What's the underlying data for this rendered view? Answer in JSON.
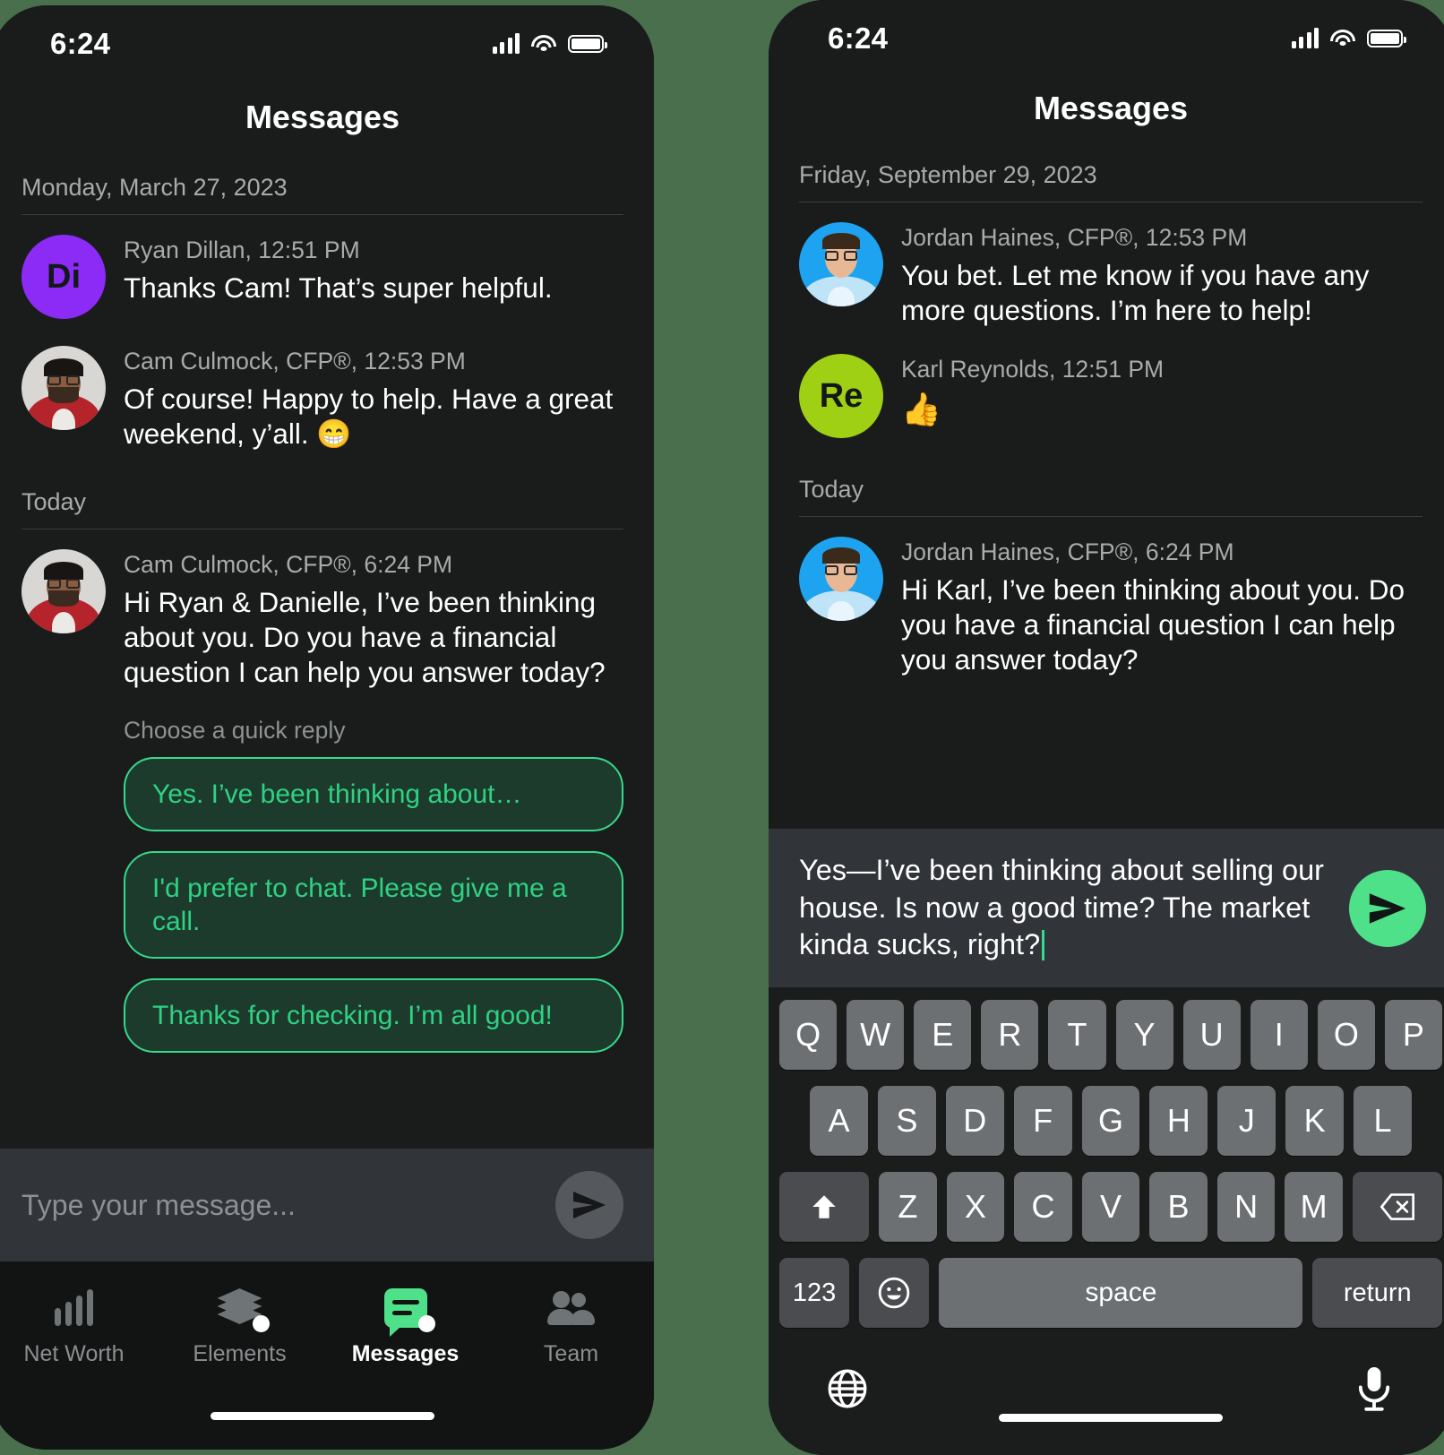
{
  "theme": {
    "page_background": "#4a6f4d",
    "screen_background": "#1a1c1c",
    "accent_green": "#4fe08a",
    "quick_reply_border": "#36d98a",
    "quick_reply_fill": "#1d3b2c",
    "quick_reply_text": "#2fd183",
    "avatar_purple": "#8b2bf5",
    "avatar_lime": "#9fd014",
    "muted_text": "#a9abab"
  },
  "left_phone": {
    "status": {
      "clock": "6:24",
      "signal_icon": "cellular-signal-icon",
      "wifi_icon": "wifi-icon",
      "battery_icon": "battery-full-icon"
    },
    "nav": {
      "title": "Messages"
    },
    "sections": [
      {
        "day_label": "Monday, March 27, 2023",
        "messages": [
          {
            "avatar_type": "initials",
            "avatar_initials": "Di",
            "avatar_color": "#8b2bf5",
            "meta": "Ryan Dillan, 12:51 PM",
            "text": "Thanks Cam! That’s super helpful."
          },
          {
            "avatar_type": "photo",
            "avatar_name": "cam-culmock-avatar",
            "meta": "Cam Culmock, CFP®, 12:53 PM",
            "text": "Of course! Happy to help. Have a great weekend, y’all. 😁"
          }
        ]
      },
      {
        "day_label": "Today",
        "messages": [
          {
            "avatar_type": "photo",
            "avatar_name": "cam-culmock-avatar",
            "meta": "Cam Culmock, CFP®, 6:24 PM",
            "text": "Hi Ryan & Danielle, I’ve been thinking about you. Do you have a financial question I can help you answer today?"
          }
        ]
      }
    ],
    "quick_reply": {
      "label": "Choose a quick reply",
      "options": [
        "Yes. I’ve been thinking about…",
        "I'd prefer to chat. Please give me a call.",
        "Thanks for checking. I’m all good!"
      ]
    },
    "composer": {
      "placeholder": "Type your message...",
      "send_icon": "send-paper-plane-icon"
    },
    "tabbar": {
      "items": [
        {
          "label": "Net Worth",
          "icon": "bar-chart-icon",
          "active": false,
          "badge": false
        },
        {
          "label": "Elements",
          "icon": "layers-icon",
          "active": false,
          "badge": true
        },
        {
          "label": "Messages",
          "icon": "chat-bubble-icon",
          "active": true,
          "badge": true
        },
        {
          "label": "Team",
          "icon": "people-icon",
          "active": false,
          "badge": false
        }
      ]
    }
  },
  "right_phone": {
    "status": {
      "clock": "6:24",
      "signal_icon": "cellular-signal-icon",
      "wifi_icon": "wifi-icon",
      "battery_icon": "battery-full-icon"
    },
    "nav": {
      "title": "Messages"
    },
    "sections": [
      {
        "day_label": "Friday, September 29, 2023",
        "messages": [
          {
            "avatar_type": "photo",
            "avatar_name": "jordan-haines-avatar",
            "meta": "Jordan Haines, CFP®, 12:53 PM",
            "text": "You bet. Let me know if you have any more questions. I’m here to help!"
          },
          {
            "avatar_type": "initials",
            "avatar_initials": "Re",
            "avatar_color": "#9fd014",
            "meta": "Karl Reynolds, 12:51 PM",
            "text": "👍"
          }
        ]
      },
      {
        "day_label": "Today",
        "messages": [
          {
            "avatar_type": "photo",
            "avatar_name": "jordan-haines-avatar",
            "meta": "Jordan Haines, CFP®, 6:24 PM",
            "text": "Hi Karl, I’ve been thinking about you. Do you have a financial question I can help you answer today?"
          }
        ]
      }
    ],
    "composer": {
      "typed_text": "Yes—I’ve been thinking about selling our house. Is now a good time? The market kinda sucks, right?",
      "send_icon": "send-paper-plane-icon",
      "caret_visible": true
    },
    "keyboard": {
      "row1": [
        "Q",
        "W",
        "E",
        "R",
        "T",
        "Y",
        "U",
        "I",
        "O",
        "P"
      ],
      "row2": [
        "A",
        "S",
        "D",
        "F",
        "G",
        "H",
        "J",
        "K",
        "L"
      ],
      "row3_shift_icon": "shift-arrow-icon",
      "row3": [
        "Z",
        "X",
        "C",
        "V",
        "B",
        "N",
        "M"
      ],
      "row3_backspace_icon": "backspace-delete-icon",
      "numbers_key": "123",
      "emoji_key_icon": "emoji-smiley-icon",
      "space_key": "space",
      "return_key": "return",
      "globe_icon": "globe-language-icon",
      "mic_icon": "microphone-dictation-icon"
    }
  }
}
